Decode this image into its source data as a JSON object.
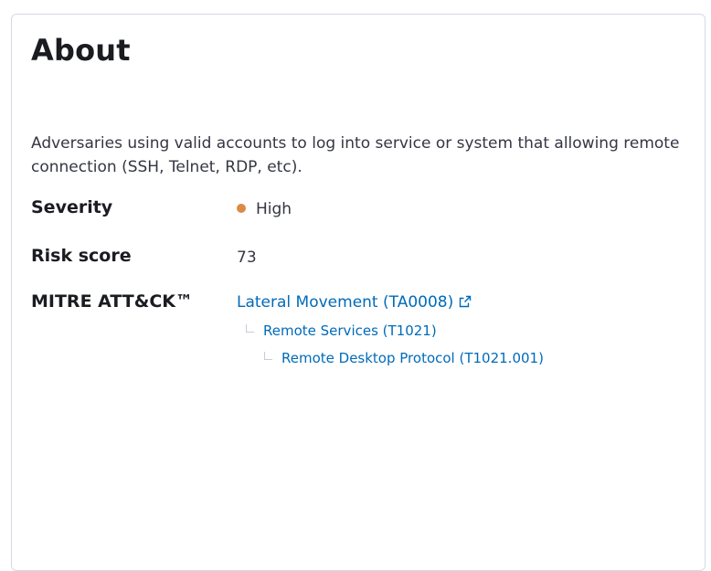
{
  "about": {
    "title": "About",
    "description": "Adversaries using valid accounts to log into service or system that allowing remote connection (SSH, Telnet, RDP, etc).",
    "severity_label": "Severity",
    "severity_value": "High",
    "severity_color": "#da8b45",
    "risk_label": "Risk score",
    "risk_value": "73",
    "mitre_label": "MITRE ATT&CK™",
    "tactic": "Lateral Movement (TA0008)",
    "technique": "Remote Services (T1021)",
    "subtechnique": "Remote Desktop Protocol (T1021.001)"
  },
  "icons": {
    "external": "external-link-icon"
  },
  "colors": {
    "link": "#006bb8",
    "border": "#d3dae6"
  }
}
